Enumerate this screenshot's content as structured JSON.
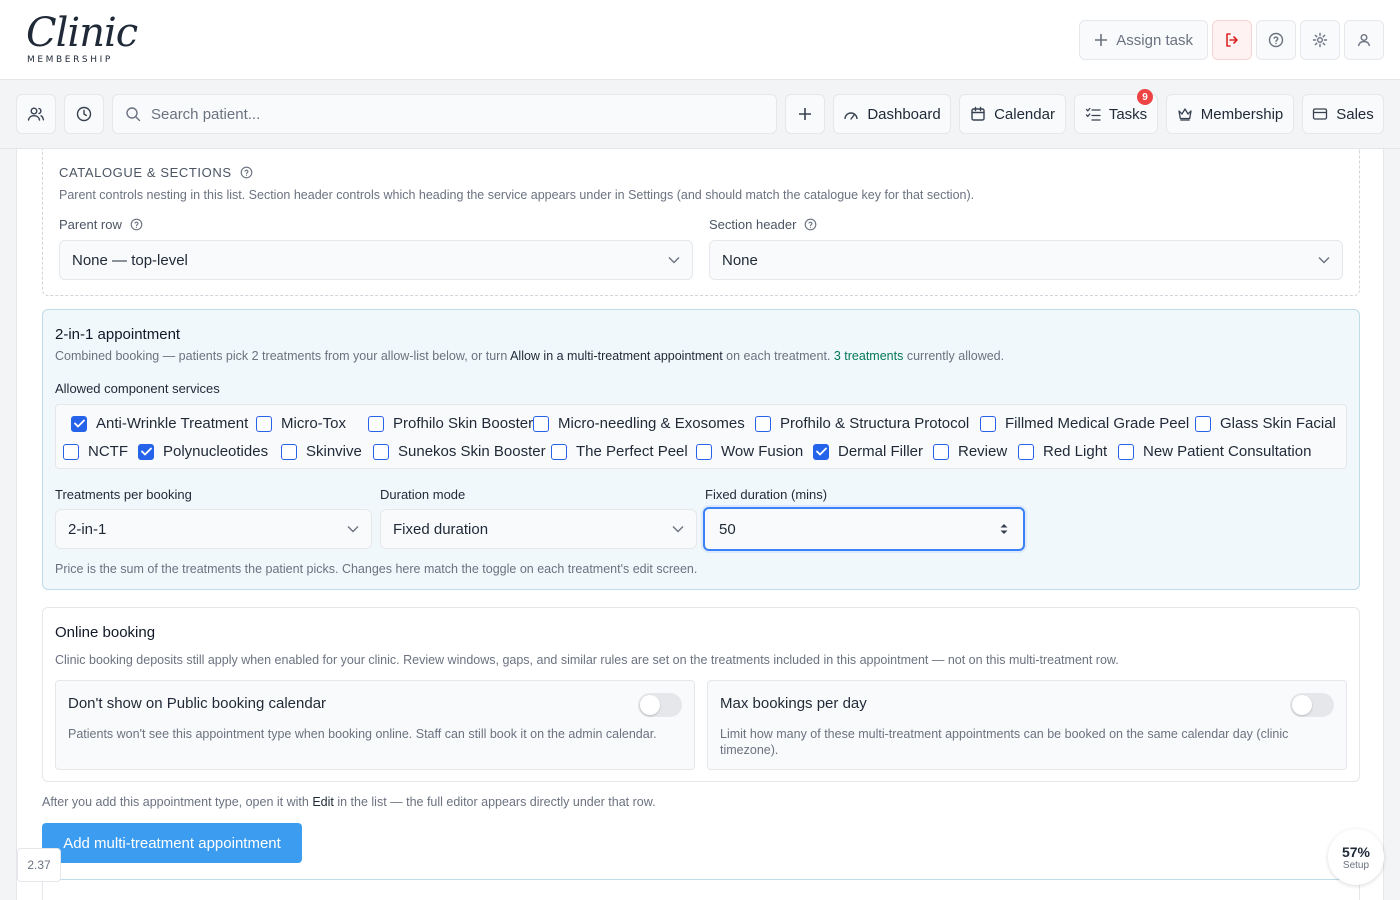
{
  "header": {
    "logo_script": "Clinic",
    "logo_sub": "MEMBERSHIP",
    "assign_task": "Assign task"
  },
  "nav": {
    "search_placeholder": "Search patient...",
    "dashboard": "Dashboard",
    "calendar": "Calendar",
    "tasks": "Tasks",
    "tasks_badge": "9",
    "membership": "Membership",
    "sales": "Sales"
  },
  "catalogue": {
    "title": "CATALOGUE & SECTIONS",
    "description": "Parent controls nesting in this list. Section header controls which heading the service appears under in Settings (and should match the catalogue key for that section).",
    "parent_row_label": "Parent row",
    "parent_row_value": "None — top-level",
    "section_header_label": "Section header",
    "section_header_value": "None"
  },
  "two_in_one": {
    "title": "2-in-1 appointment",
    "desc_pre": "Combined booking — patients pick 2 treatments from your allow-list below, or turn ",
    "desc_bold": "Allow in a multi-treatment appointment",
    "desc_mid": " on each treatment. ",
    "desc_green": "3 treatments",
    "desc_post": " currently allowed.",
    "allowed_label": "Allowed component services",
    "services": [
      {
        "label": "Anti-Wrinkle Treatment",
        "checked": true
      },
      {
        "label": "Micro-Tox",
        "checked": false
      },
      {
        "label": "Profhilo Skin Booster",
        "checked": false
      },
      {
        "label": "Micro-needling & Exosomes",
        "checked": false
      },
      {
        "label": "Profhilo & Structura Protocol",
        "checked": false
      },
      {
        "label": "Fillmed Medical Grade Peel",
        "checked": false
      },
      {
        "label": "Glass Skin Facial",
        "checked": false
      },
      {
        "label": "NCTF",
        "checked": false
      },
      {
        "label": "Polynucleotides",
        "checked": true
      },
      {
        "label": "Skinvive",
        "checked": false
      },
      {
        "label": "Sunekos Skin Booster",
        "checked": false
      },
      {
        "label": "The Perfect Peel",
        "checked": false
      },
      {
        "label": "Wow Fusion",
        "checked": false
      },
      {
        "label": "Dermal Filler",
        "checked": true
      },
      {
        "label": "Review",
        "checked": false
      },
      {
        "label": "Red Light",
        "checked": false
      },
      {
        "label": "New Patient Consultation",
        "checked": false
      }
    ],
    "treatments_per_booking_label": "Treatments per booking",
    "treatments_per_booking_value": "2-in-1",
    "duration_mode_label": "Duration mode",
    "duration_mode_value": "Fixed duration",
    "fixed_duration_label": "Fixed duration (mins)",
    "fixed_duration_value": "50",
    "help": "Price is the sum of the treatments the patient picks. Changes here match the toggle on each treatment's edit screen."
  },
  "online": {
    "title": "Online booking",
    "description": "Clinic booking deposits still apply when enabled for your clinic. Review windows, gaps, and similar rules are set on the treatments included in this appointment — not on this multi-treatment row.",
    "public_title": "Don't show on Public booking calendar",
    "public_desc": "Patients won't see this appointment type when booking online. Staff can still book it on the admin calendar.",
    "public_enabled": false,
    "max_title": "Max bookings per day",
    "max_desc": "Limit how many of these multi-treatment appointments can be booked on the same calendar day (clinic timezone).",
    "max_enabled": false
  },
  "footer": {
    "note_pre": "After you add this appointment type, open it with ",
    "note_bold": "Edit",
    "note_post": " in the list — the full editor appears directly under that row.",
    "add_button": "Add multi-treatment appointment",
    "version": "2.37",
    "setup_pct": "57%",
    "setup_label": "Setup"
  },
  "colors": {
    "accent": "#3b9cf0",
    "checkbox": "#2563eb",
    "danger": "#dc2626",
    "success_text": "#047857"
  }
}
